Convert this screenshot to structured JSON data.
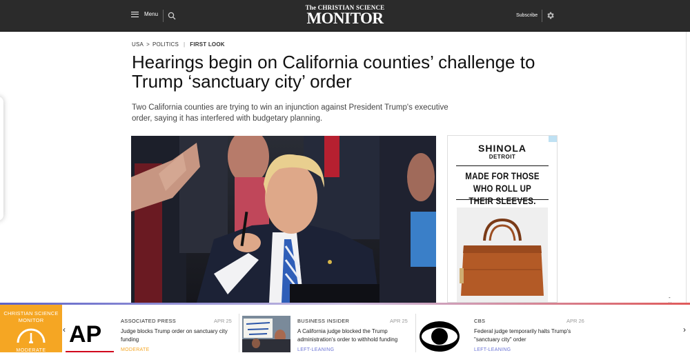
{
  "header": {
    "menu_label": "Menu",
    "logo_line1": "The CHRISTIAN SCIENCE",
    "logo_line2": "MONITOR",
    "subscribe_label": "Subscribe"
  },
  "article": {
    "breadcrumb": [
      "USA",
      "POLITICS"
    ],
    "breadcrumb_sep": ">",
    "section_label": "FIRST LOOK",
    "headline": "Hearings begin on California counties’ challenge to Trump ‘sanctuary city’ order",
    "dek": "Two California counties are trying to win an injunction against President Trump's executive order, saying it has interfered with budgetary planning."
  },
  "ad": {
    "brand": "SHINOLA",
    "city": "DETROIT",
    "tagline": "MADE FOR THOSE WHO ROLL UP THEIR SLEEVES."
  },
  "bottom_bar": {
    "close_label": "- x",
    "badge_title": "CHRISTIAN SCIENCE MONITOR",
    "badge_rating": "MODERATE",
    "cards": [
      {
        "source": "ASSOCIATED PRESS",
        "date": "APR 25",
        "title": "Judge blocks Trump order on sanctuary city funding",
        "lean": "MODERATE",
        "lean_color": "#f5a623",
        "logo_text": "AP"
      },
      {
        "source": "BUSINESS INSIDER",
        "date": "APR 25",
        "title": "A California judge blocked the Trump administration's order to withhold funding",
        "lean": "LEFT-LEANING",
        "lean_color": "#6b74d6"
      },
      {
        "source": "CBS",
        "date": "APR 26",
        "title": "Federal judge temporarily halts Trump's \"sanctuary city\" order",
        "lean": "LEFT-LEANING",
        "lean_color": "#6b74d6"
      }
    ]
  },
  "colors": {
    "header_bg": "#2b2b2b",
    "badge_bg": "#f5a623",
    "accent_blue": "#5a62c9",
    "accent_red": "#e05a5a"
  }
}
